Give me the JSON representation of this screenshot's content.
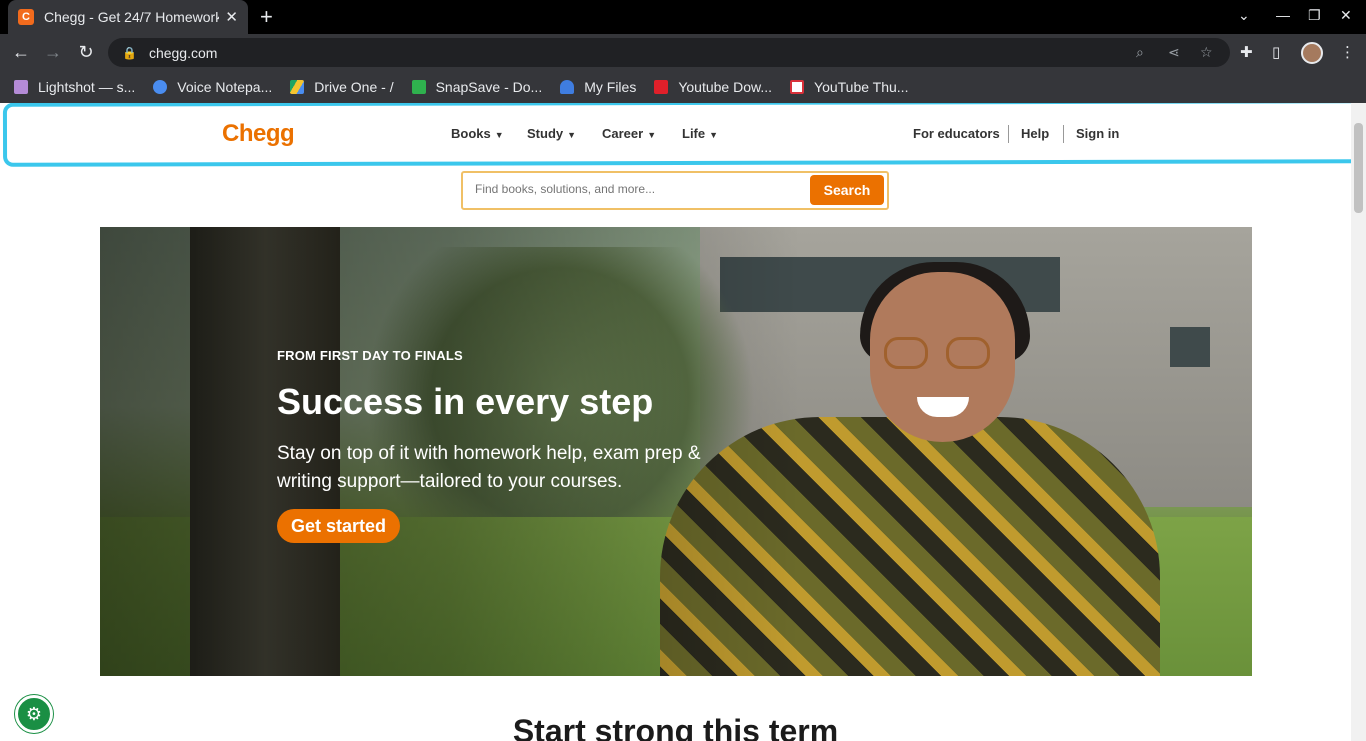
{
  "browser": {
    "tab_title": "Chegg - Get 24/7 Homework",
    "tab_favicon_letter": "C",
    "url": "chegg.com",
    "bookmarks": [
      {
        "label": "Lightshot — s...",
        "color": "#b48bd6"
      },
      {
        "label": "Voice Notepa...",
        "color": "#4a8df0"
      },
      {
        "label": "Drive One - /",
        "color": "#f4c430"
      },
      {
        "label": "SnapSave - Do...",
        "color": "#2fb14e"
      },
      {
        "label": "My Files",
        "color": "#3f7de0"
      },
      {
        "label": "Youtube Dow...",
        "color": "#e0202a"
      },
      {
        "label": "YouTube Thu...",
        "color": "#d8313a"
      }
    ]
  },
  "header": {
    "logo": "Chegg",
    "nav": [
      "Books",
      "Study",
      "Career",
      "Life"
    ],
    "educators": "For educators",
    "help": "Help",
    "signin": "Sign in"
  },
  "search": {
    "placeholder": "Find books, solutions, and more...",
    "button": "Search"
  },
  "hero": {
    "eyebrow": "FROM FIRST DAY TO FINALS",
    "title": "Success in every step",
    "subtitle": "Stay on top of it with homework help, exam prep & writing support—tailored to your courses.",
    "cta": "Get started"
  },
  "section": {
    "title": "Start strong this term"
  },
  "colors": {
    "brand": "#eb7100",
    "highlight": "#3bc7ec"
  }
}
